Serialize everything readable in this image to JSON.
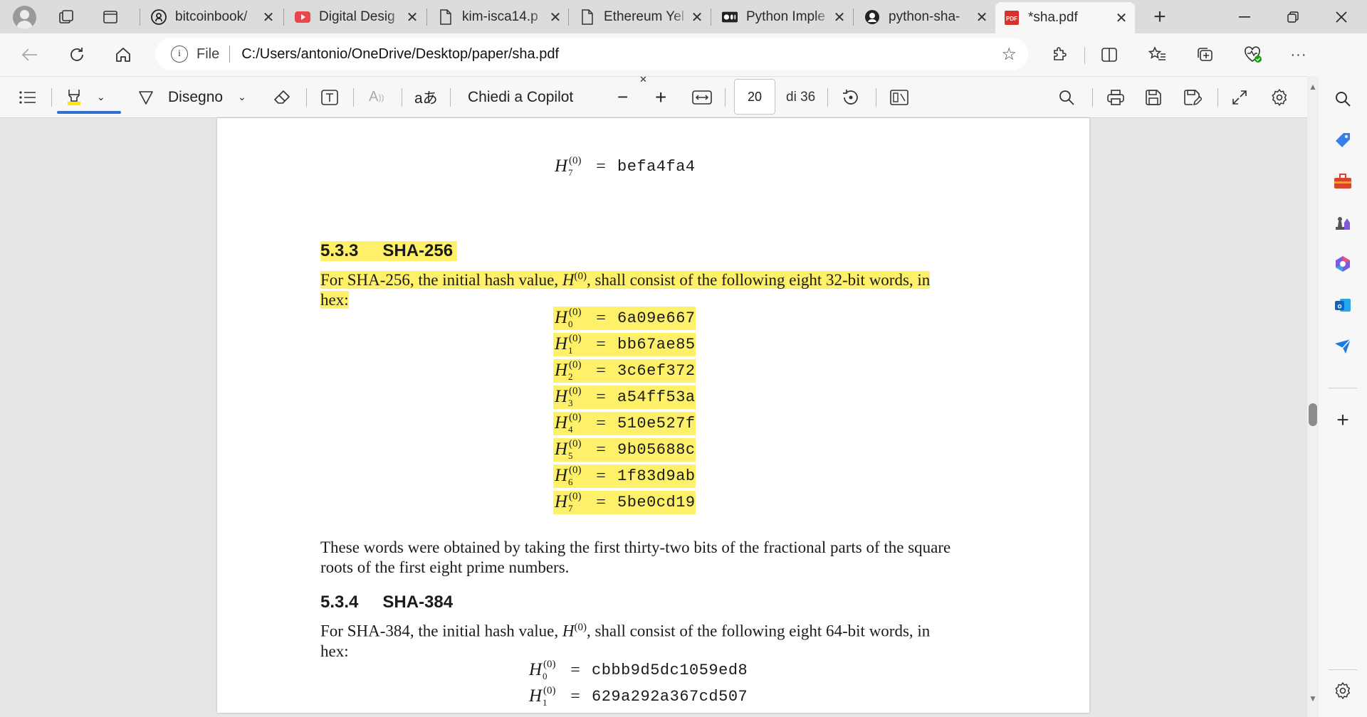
{
  "tabs": [
    {
      "title": "bitcoinbook/",
      "favicon": "github-icon"
    },
    {
      "title": "Digital Desig",
      "favicon": "youtube-icon"
    },
    {
      "title": "kim-isca14.p",
      "favicon": "document-icon"
    },
    {
      "title": "Ethereum Yel",
      "favicon": "document-icon"
    },
    {
      "title": "Python Imple",
      "favicon": "medium-icon"
    },
    {
      "title": "python-sha-",
      "favicon": "github-icon"
    },
    {
      "title": "*sha.pdf",
      "favicon": "pdf-icon",
      "active": true
    }
  ],
  "tab_close_glyph": "✕",
  "new_tab_glyph": "+",
  "address": {
    "scheme_label": "File",
    "url": "C:/Users/antonio/OneDrive/Desktop/paper/sha.pdf"
  },
  "pdf_toolbar": {
    "draw_label": "Disegno",
    "copilot_label": "Chiedi a Copilot",
    "page_current": "20",
    "page_total_label": "di 36",
    "zoom_out_glyph": "−",
    "zoom_in_glyph": "+"
  },
  "document": {
    "top_equation": {
      "H": "H",
      "sup": "(0)",
      "sub": "7",
      "eq": "=",
      "value": "befa4fa4"
    },
    "section_533": {
      "number": "5.3.3",
      "title": "SHA-256",
      "intro_line1_a": "For SHA-256, the initial hash value, ",
      "intro_line1_H": "H",
      "intro_line1_sup": "(0)",
      "intro_line1_b": ", shall consist of the following eight 32-bit words, in",
      "intro_line2": "hex:",
      "rows": [
        {
          "sub": "0",
          "value": "6a09e667"
        },
        {
          "sub": "1",
          "value": "bb67ae85"
        },
        {
          "sub": "2",
          "value": "3c6ef372"
        },
        {
          "sub": "3",
          "value": "a54ff53a"
        },
        {
          "sub": "4",
          "value": "510e527f"
        },
        {
          "sub": "5",
          "value": "9b05688c"
        },
        {
          "sub": "6",
          "value": "1f83d9ab"
        },
        {
          "sub": "7",
          "value": "5be0cd19"
        }
      ],
      "note_line1": "These words were obtained by taking the first thirty-two bits of the fractional parts of the square",
      "note_line2": "roots of the first eight prime numbers."
    },
    "section_534": {
      "number": "5.3.4",
      "title": "SHA-384",
      "intro_line1_a": "For SHA-384, the initial hash value, ",
      "intro_line1_H": "H",
      "intro_line1_sup": "(0)",
      "intro_line1_b": ", shall consist of the following eight 64-bit words, in",
      "intro_line2": "hex:",
      "rows": [
        {
          "sub": "0",
          "value": "cbbb9d5dc1059ed8"
        },
        {
          "sub": "1",
          "value": "629a292a367cd507"
        }
      ]
    },
    "H_symbol": "H",
    "H_sup": "(0)",
    "eq_sign": "="
  },
  "colors": {
    "highlight": "#fff06a",
    "accent": "#2f6fd0"
  }
}
